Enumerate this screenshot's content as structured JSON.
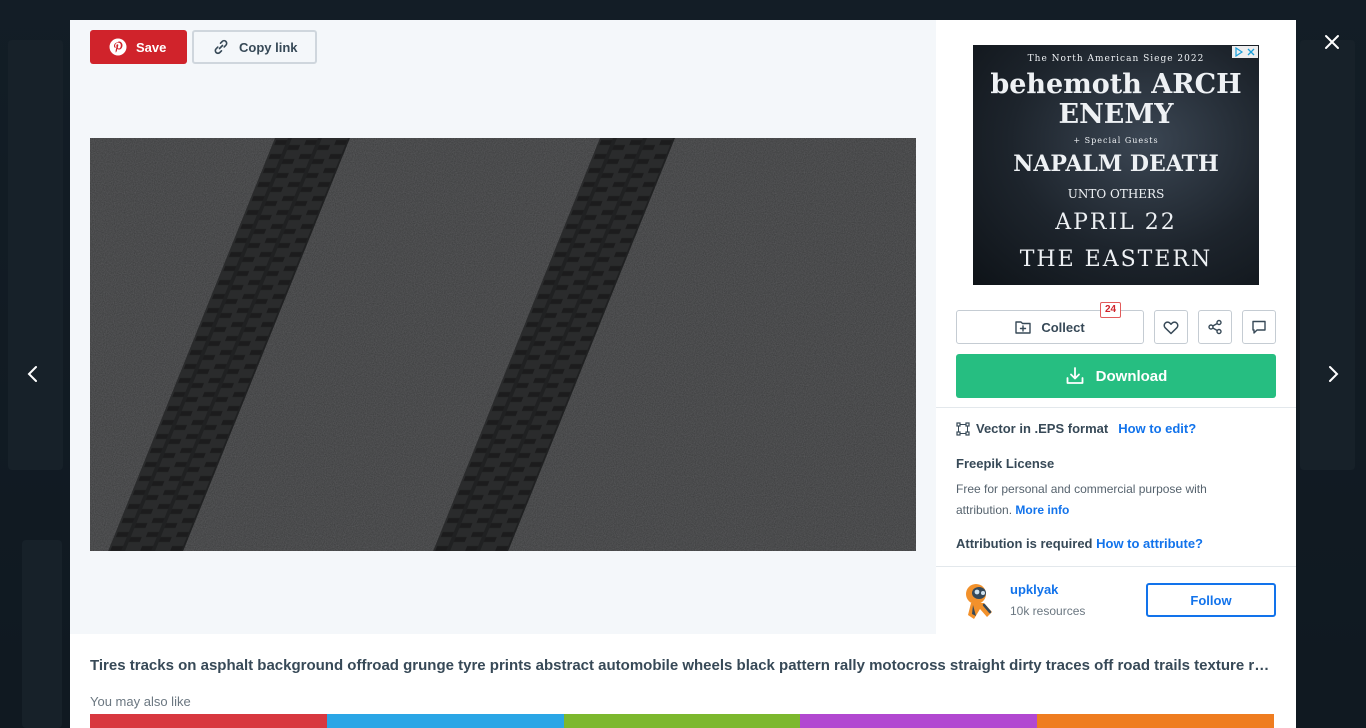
{
  "toolbar": {
    "save_label": "Save",
    "copy_label": "Copy link"
  },
  "ad": {
    "tour": "The North American Siege 2022",
    "headliner_1": "behemoth",
    "headliner_2": "ARCH ENEMY",
    "special": "+ Special Guests",
    "support_1": "NAPALM DEATH",
    "support_2": "UNTO OTHERS",
    "date": "APRIL 22",
    "venue": "THE EASTERN"
  },
  "actions": {
    "collect_label": "Collect",
    "like_count": "24",
    "download_label": "Download"
  },
  "format": {
    "label": "Vector in .EPS format",
    "link": "How to edit?"
  },
  "license": {
    "title": "Freepik License",
    "text": "Free for personal and commercial purpose with attribution.",
    "more_link": "More info",
    "attribution_label": "Attribution is required",
    "attribution_link": "How to attribute?"
  },
  "author": {
    "name": "upklyak",
    "resources": "10k resources",
    "follow_label": "Follow"
  },
  "description": "Tires tracks on asphalt background offroad grunge tyre prints abstract automobile wheels black pattern rally motocross straight dirty traces off road trails texture realistic vector illustration",
  "related": {
    "heading": "You may also like",
    "colors": [
      "#d8383f",
      "#2aa6e6",
      "#7cb82e",
      "#b248d1",
      "#ef7d20"
    ]
  },
  "colors": {
    "save_red": "#d0232b",
    "download_green": "#26be81",
    "link_blue": "#1273eb",
    "asphalt": "#3a3b3c",
    "tread": "#1c1c1d"
  }
}
